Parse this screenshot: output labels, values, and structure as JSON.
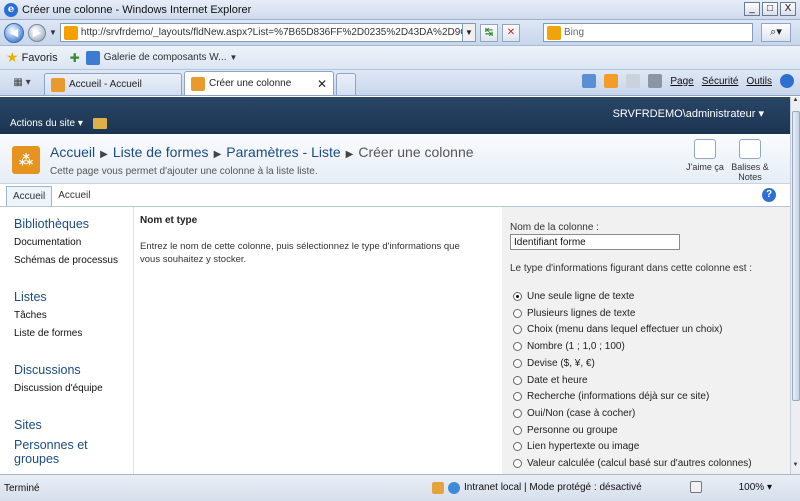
{
  "window": {
    "title": "Créer une colonne - Windows Internet Explorer",
    "min": "_",
    "max": "□",
    "close": "X"
  },
  "address": {
    "url": "http://srvfrdemo/_layouts/fldNew.aspx?List=%7B65D836FF%2D0235%2D43DA%2D9C17%2D1",
    "search_placeholder": "Bing"
  },
  "favorites": {
    "label": "Favoris",
    "gallery": "Galerie de composants W..."
  },
  "tabs": [
    {
      "label": "Accueil - Accueil"
    },
    {
      "label": "Créer une colonne"
    }
  ],
  "command_bar": {
    "page": "Page",
    "security": "Sécurité",
    "tools": "Outils"
  },
  "sharepoint": {
    "user": "SRVFRDEMO\\administrateur",
    "site_actions": "Actions du site"
  },
  "breadcrumb": {
    "site": "Accueil",
    "list": "Liste de formes",
    "settings": "Paramètres - Liste",
    "current": "Créer une colonne",
    "description": "Cette page vous permet d'ajouter une colonne à la liste liste."
  },
  "social": {
    "like": "J'aime ça",
    "tags_line1": "Balises &",
    "tags_line2": "Notes"
  },
  "ribbon": {
    "tab_active": "Accueil",
    "tab_home": "Accueil",
    "help": "?"
  },
  "leftnav": {
    "libraries": "Bibliothèques",
    "documentation": "Documentation",
    "process_diagrams": "Schémas de processus",
    "lists": "Listes",
    "tasks": "Tâches",
    "shapes_list": "Liste de formes",
    "discussions": "Discussions",
    "team_discussion": "Discussion d'équipe",
    "sites": "Sites",
    "people_groups_1": "Personnes et",
    "people_groups_2": "groupes"
  },
  "form": {
    "section_title": "Nom et type",
    "section_desc": "Entrez le nom de cette colonne, puis sélectionnez le type d'informations que vous souhaitez y stocker.",
    "column_name_label": "Nom de la colonne :",
    "column_name_value": "Identifiant forme",
    "type_label": "Le type d'informations figurant dans cette colonne est :",
    "types": [
      {
        "label": "Une seule ligne de texte",
        "checked": true
      },
      {
        "label": "Plusieurs lignes de texte",
        "checked": false
      },
      {
        "label": "Choix (menu dans lequel effectuer un choix)",
        "checked": false
      },
      {
        "label": "Nombre (1 ; 1,0 ; 100)",
        "checked": false
      },
      {
        "label": "Devise ($, ¥, €)",
        "checked": false
      },
      {
        "label": "Date et heure",
        "checked": false
      },
      {
        "label": "Recherche (informations déjà sur ce site)",
        "checked": false
      },
      {
        "label": "Oui/Non (case à cocher)",
        "checked": false
      },
      {
        "label": "Personne ou groupe",
        "checked": false
      },
      {
        "label": "Lien hypertexte ou image",
        "checked": false
      },
      {
        "label": "Valeur calculée (calcul basé sur d'autres colonnes)",
        "checked": false
      }
    ]
  },
  "statusbar": {
    "status": "Terminé",
    "zone": "Intranet local | Mode protégé : désactivé",
    "zoom": "100%"
  }
}
